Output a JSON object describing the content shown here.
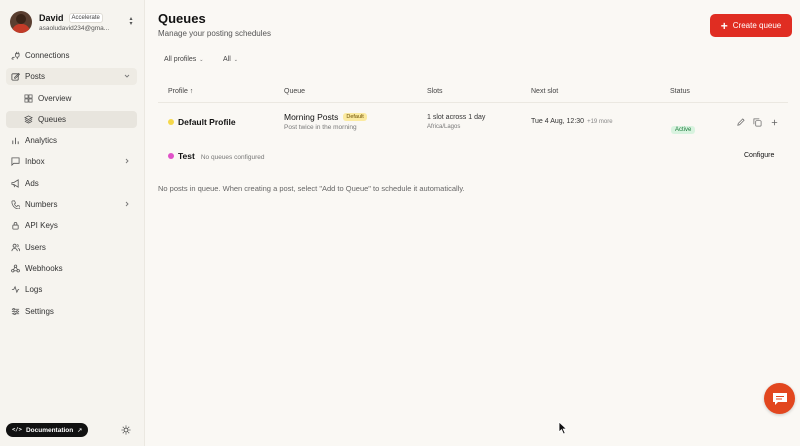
{
  "user": {
    "name": "David",
    "plan": "Accelerate",
    "email": "asaoludavid234@gma..."
  },
  "nav": {
    "connections": "Connections",
    "posts": "Posts",
    "overview": "Overview",
    "queues": "Queues",
    "analytics": "Analytics",
    "inbox": "Inbox",
    "ads": "Ads",
    "numbers": "Numbers",
    "api_keys": "API Keys",
    "users": "Users",
    "webhooks": "Webhooks",
    "logs": "Logs",
    "settings": "Settings"
  },
  "footer": {
    "documentation": "Documentation"
  },
  "page": {
    "title": "Queues",
    "subtitle": "Manage your posting schedules",
    "create_label": "Create queue"
  },
  "filters": {
    "profiles": "All profiles",
    "status": "All"
  },
  "table": {
    "headers": {
      "profile": "Profile ↑",
      "queue": "Queue",
      "slots": "Slots",
      "next_slot": "Next slot",
      "status": "Status"
    },
    "rows": [
      {
        "profile": "Default Profile",
        "profile_color": "#f5d84a",
        "queue_name": "Morning Posts",
        "queue_badge": "Default",
        "queue_desc": "Post twice in the morning",
        "slots": "1 slot across 1 day",
        "timezone": "Africa/Lagos",
        "next_slot": "Tue 4 Aug, 12:30",
        "next_more": "+19 more",
        "status": "Active"
      },
      {
        "profile": "Test",
        "profile_color": "#e052c8",
        "note": "No queues configured",
        "action": "Configure"
      }
    ]
  },
  "empty_message": "No posts in queue. When creating a post, select \"Add to Queue\" to schedule it automatically.",
  "colors": {
    "accent": "#e02d22",
    "chat": "#e2471f",
    "background": "#faf8f4"
  }
}
